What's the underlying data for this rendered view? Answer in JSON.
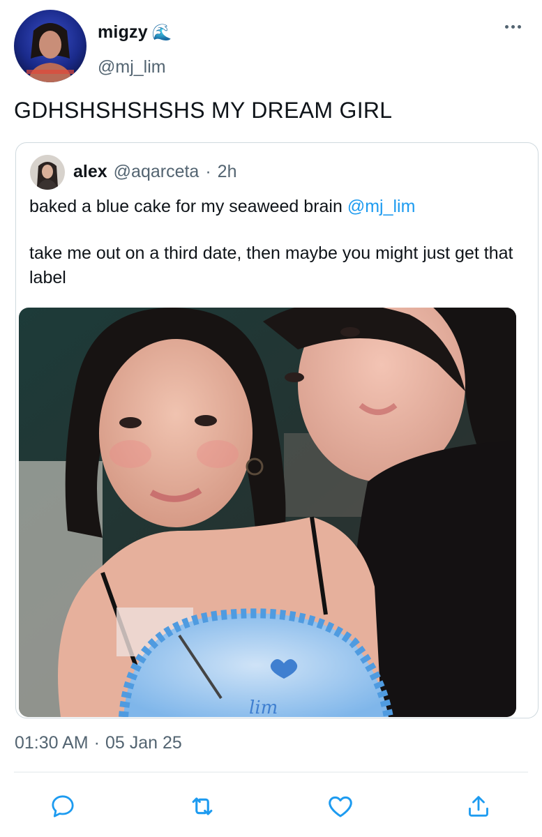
{
  "author": {
    "display_name": "migzy",
    "name_emoji": "🌊",
    "handle": "@mj_lim"
  },
  "tweet": {
    "text": "GDHSHSHSHSHS MY DREAM GIRL",
    "timestamp_time": "01:30 AM",
    "timestamp_sep": "·",
    "timestamp_date": "05 Jan 25"
  },
  "quoted": {
    "display_name": "alex",
    "handle": "@aqarceta",
    "sep": "·",
    "time": "2h",
    "line1_text": "baked a blue cake for my seaweed brain ",
    "line1_mention": "@mj_lim",
    "line2_text": "take me out on a third date, then maybe you might just get that label",
    "cake_writing": "lim"
  },
  "actions": [
    {
      "name": "reply",
      "icon": "comment-icon"
    },
    {
      "name": "retweet",
      "icon": "retweet-icon"
    },
    {
      "name": "like",
      "icon": "heart-icon"
    },
    {
      "name": "share",
      "icon": "share-icon"
    }
  ],
  "colors": {
    "link": "#1d9bf0",
    "secondary_text": "#536471",
    "border": "#cfd9de"
  }
}
